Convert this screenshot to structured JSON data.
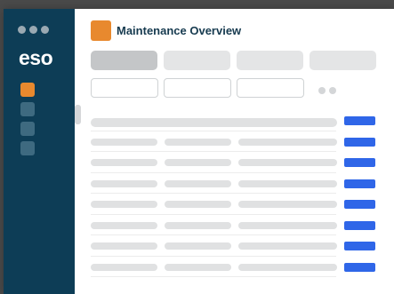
{
  "app": {
    "logo_text": "eso",
    "page_title": "Maintenance Overview"
  },
  "colors": {
    "sidebar": "#0d3d56",
    "accent": "#e8892e",
    "action": "#2f66e8"
  },
  "sidebar": {
    "items": [
      {
        "name": "nav-item-1",
        "active": true
      },
      {
        "name": "nav-item-2",
        "active": false
      },
      {
        "name": "nav-item-3",
        "active": false
      },
      {
        "name": "nav-item-4",
        "active": false
      }
    ]
  },
  "tabs": [
    {
      "label": "",
      "active": true
    },
    {
      "label": "",
      "active": false
    },
    {
      "label": "",
      "active": false
    },
    {
      "label": "",
      "active": false
    }
  ],
  "filters": [
    {
      "value": ""
    },
    {
      "value": ""
    },
    {
      "value": ""
    }
  ],
  "table": {
    "rows": 7
  }
}
